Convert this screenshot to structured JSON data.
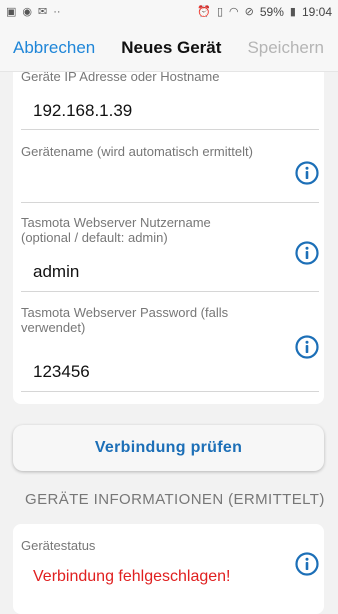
{
  "statusbar": {
    "battery_percent": "59%",
    "time": "19:04"
  },
  "nav": {
    "cancel_label": "Abbrechen",
    "title": "Neues Gerät",
    "save_label": "Speichern"
  },
  "form": {
    "ip": {
      "label": "Geräte IP Adresse oder Hostname",
      "value": "192.168.1.39"
    },
    "name": {
      "label": "Gerätename (wird automatisch ermittelt)",
      "value": ""
    },
    "user": {
      "label_line1": "Tasmota Webserver Nutzername",
      "label_line2": "(optional / default: admin)",
      "value": "admin"
    },
    "password": {
      "label_line1": "Tasmota Webserver Password (falls",
      "label_line2": "verwendet)",
      "value": "123456"
    }
  },
  "check_button": {
    "label": "Verbindung prüfen"
  },
  "device_info": {
    "section_title": "GERÄTE INFORMATIONEN (ERMITTELT)",
    "status_label": "Gerätestatus",
    "status_value": "Verbindung fehlgeschlagen!"
  },
  "colors": {
    "accent": "#1f86d8",
    "info_icon": "#1c6fb7",
    "error": "#e02020"
  }
}
